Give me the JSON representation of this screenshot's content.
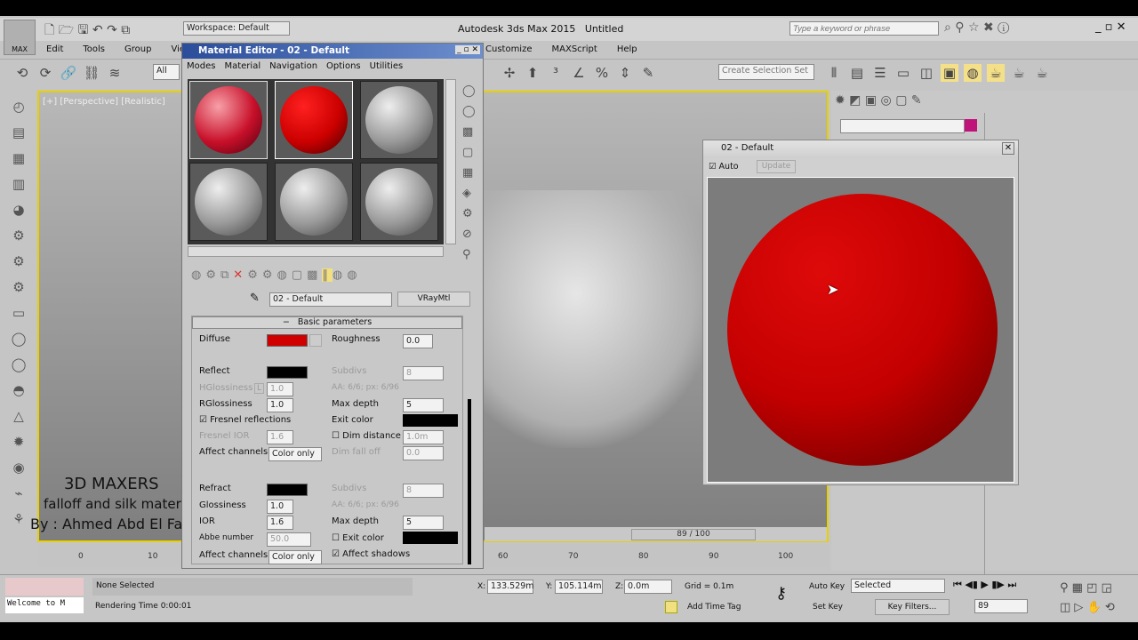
{
  "app": {
    "title": "Autodesk 3ds Max 2015",
    "doc": "Untitled",
    "logo": "MAX",
    "workspace": "Workspace: Default",
    "search_placeholder": "Type a keyword or phrase"
  },
  "menu": [
    "Edit",
    "Tools",
    "Group",
    "Views",
    "Customize",
    "MAXScript",
    "Help"
  ],
  "toolbar": {
    "filter": "All",
    "selection_set": "Create Selection Set"
  },
  "viewport": {
    "label": "[+] [Perspective] [Realistic]"
  },
  "overlay": {
    "line1": "3D MAXERS",
    "line2": "falloff and silk material",
    "line3": "By : Ahmed Abd El Fattah"
  },
  "mat_editor": {
    "title": "Material Editor - 02 - Default",
    "menu": [
      "Modes",
      "Material",
      "Navigation",
      "Options",
      "Utilities"
    ],
    "material_name": "02 - Default",
    "material_type": "VRayMtl",
    "rollout": "Basic parameters",
    "diffuse": "Diffuse",
    "roughness": "Roughness",
    "roughness_val": "0.0",
    "diffuse_color": "#d00000",
    "reflect": "Reflect",
    "subdivs": "Subdivs",
    "subdivs_val": "8",
    "hgloss": "HGlossiness",
    "L": "L",
    "hgloss_val": "1.0",
    "aa": "AA: 6/6; px: 6/96",
    "rgloss": "RGlossiness",
    "rgloss_val": "1.0",
    "maxdepth": "Max depth",
    "maxdepth_val": "5",
    "fresnel": "Fresnel reflections",
    "exit_color": "Exit color",
    "fresnel_ior": "Fresnel IOR",
    "fresnel_ior_val": "1.6",
    "dim_distance": "Dim distance",
    "dim_distance_val": "1.0m",
    "affect_channels": "Affect channels",
    "color_only": "Color only",
    "dim_falloff": "Dim fall off",
    "dim_falloff_val": "0.0",
    "refract": "Refract",
    "glossiness": "Glossiness",
    "gloss_val": "1.0",
    "ior": "IOR",
    "ior_val": "1.6",
    "abbe": "Abbe number",
    "abbe_val": "50.0",
    "exit_color2": "Exit color",
    "affect_shadows": "Affect shadows"
  },
  "render_win": {
    "title": "02 - Default",
    "auto": "Auto",
    "update": "Update",
    "sphere_color": "#cc0000"
  },
  "timeline": {
    "frame": "89 / 100",
    "ticks": [
      "0",
      "10",
      "60",
      "70",
      "80",
      "90",
      "100"
    ]
  },
  "status": {
    "selected": "None Selected",
    "x_label": "X:",
    "x": "133.529m",
    "y_label": "Y:",
    "y": "105.114m",
    "z_label": "Z:",
    "z": "0.0m",
    "grid": "Grid = 0.1m",
    "render_time": "Rendering Time  0:00:01",
    "add_time_tag": "Add Time Tag",
    "auto_key": "Auto Key",
    "set_key": "Set Key",
    "key_mode": "Selected",
    "key_filters": "Key Filters...",
    "frame": "89",
    "welcome": "Welcome to M"
  }
}
